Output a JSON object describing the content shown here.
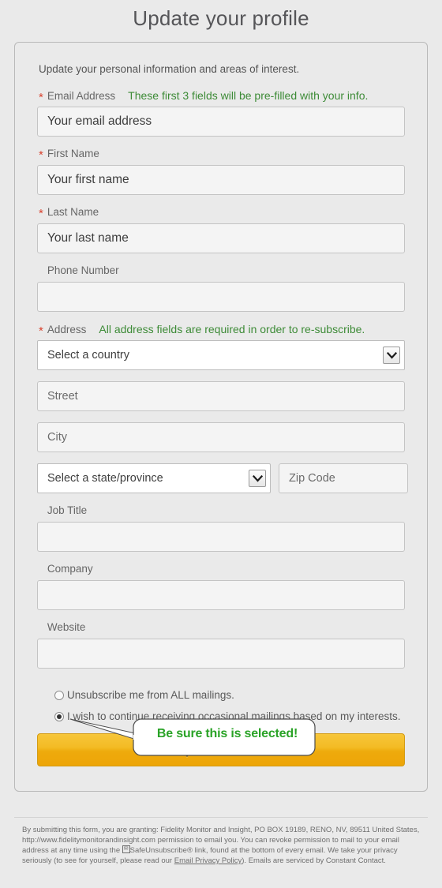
{
  "page": {
    "title": "Update your profile",
    "intro": "Update your personal information and areas of interest."
  },
  "annotations": {
    "prefill_hint": "These first 3 fields will be pre-filled with your info.",
    "address_hint": "All address fields are required in order to re-subscribe.",
    "callout": "Be sure this is selected!"
  },
  "fields": {
    "email": {
      "label": "Email Address",
      "required": true,
      "placeholder": "Your email address",
      "value": ""
    },
    "first_name": {
      "label": "First Name",
      "required": true,
      "placeholder": "Your first name",
      "value": ""
    },
    "last_name": {
      "label": "Last Name",
      "required": true,
      "placeholder": "Your last name",
      "value": ""
    },
    "phone": {
      "label": "Phone Number",
      "required": false,
      "placeholder": "",
      "value": ""
    },
    "address": {
      "label": "Address",
      "required": true
    },
    "country": {
      "selected": "Select a country",
      "placeholder": "Select a country"
    },
    "street": {
      "placeholder": "Street",
      "value": ""
    },
    "city": {
      "placeholder": "City",
      "value": ""
    },
    "state": {
      "selected": "Select a state/province",
      "placeholder": "Select a state/province"
    },
    "zip": {
      "placeholder": "Zip Code",
      "value": ""
    },
    "job_title": {
      "label": "Job Title",
      "required": false,
      "placeholder": "",
      "value": ""
    },
    "company": {
      "label": "Company",
      "required": false,
      "placeholder": "",
      "value": ""
    },
    "website": {
      "label": "Website",
      "required": false,
      "placeholder": "",
      "value": ""
    }
  },
  "mailing_options": [
    {
      "label": "Unsubscribe me from ALL mailings.",
      "selected": false
    },
    {
      "label": "I wish to continue receiving occasional mailings based on my interests.",
      "selected": true
    }
  ],
  "submit": {
    "label": "Update Profile"
  },
  "footer": {
    "part1": "By submitting this form, you are granting: Fidelity Monitor and Insight, PO BOX 19189, RENO, NV, 89511 United States, http://www.fidelitymonitorandinsight.com permission to email you. You can revoke permission to mail to your email address at any time using the ",
    "safe_unsubscribe": "SafeUnsubscribe®",
    "part2": " link, found at the bottom of every email. We take your privacy seriously (to see for yourself, please read our ",
    "privacy_link": "Email Privacy Policy",
    "part3": "). Emails are serviced by Constant Contact."
  },
  "colors": {
    "accent_green": "#3d8b37",
    "callout_green": "#2aa327",
    "required_red": "#d9432f",
    "button_gold": "#eeaa0c",
    "page_bg": "#eaeaea"
  },
  "icons": {
    "chevron_down": "chevron-down-icon",
    "envelope": "envelope-icon"
  }
}
